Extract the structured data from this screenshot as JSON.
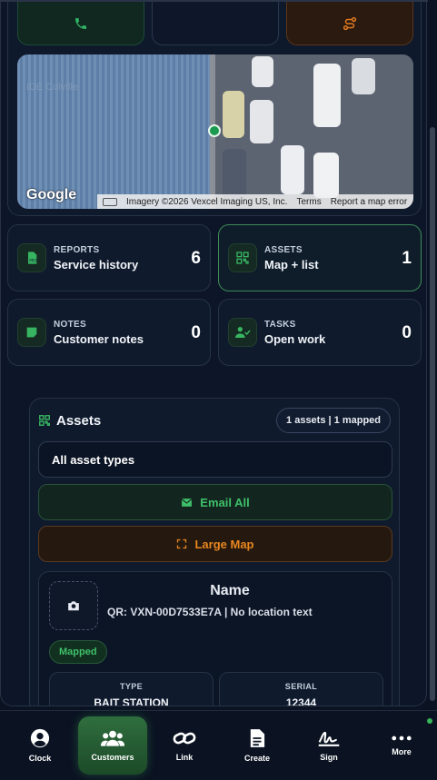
{
  "map": {
    "google_logo": "Google",
    "imagery_credit": "Imagery ©2026 Vexcel Imaging US, Inc.",
    "terms_link": "Terms",
    "report_link": "Report a map error"
  },
  "stats": {
    "reports": {
      "kicker": "REPORTS",
      "title": "Service history",
      "count": "6"
    },
    "assets": {
      "kicker": "ASSETS",
      "title": "Map + list",
      "count": "1"
    },
    "notes": {
      "kicker": "NOTES",
      "title": "Customer notes",
      "count": "0"
    },
    "tasks": {
      "kicker": "TASKS",
      "title": "Open work",
      "count": "0"
    }
  },
  "assets_section": {
    "title": "Assets",
    "badge": "1 assets | 1 mapped",
    "type_select": "All asset types",
    "email_all_label": "Email All",
    "large_map_label": "Large Map",
    "asset": {
      "name": "Name",
      "qr_line": "QR: VXN-00D7533E7A | No location text",
      "status": "Mapped",
      "type_label": "TYPE",
      "type_value": "BAIT STATION",
      "serial_label": "SERIAL",
      "serial_value": "12344"
    }
  },
  "nav": {
    "clock": "Clock",
    "customers": "Customers",
    "link": "Link",
    "create": "Create",
    "sign": "Sign",
    "more": "More"
  },
  "colors": {
    "accent_green": "#3fc06a",
    "accent_orange": "#e8861f",
    "background": "#0b1322"
  }
}
